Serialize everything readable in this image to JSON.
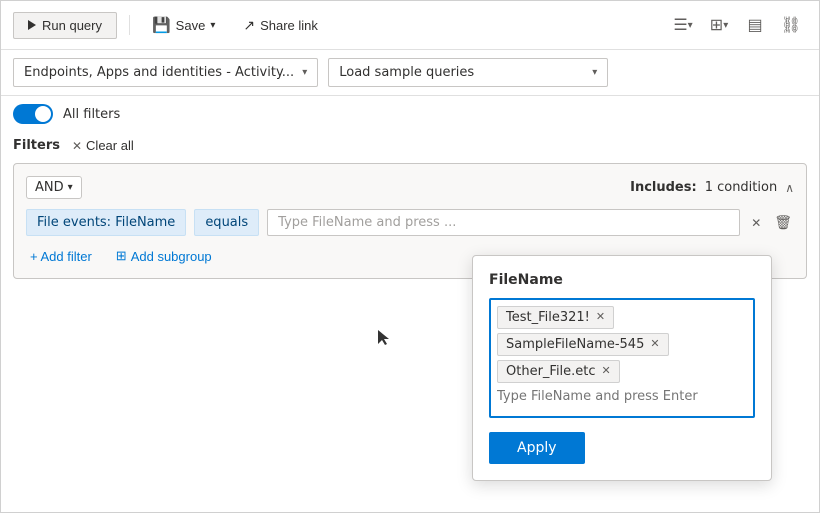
{
  "toolbar": {
    "run_query": "Run query",
    "save": "Save",
    "share_link": "Share link"
  },
  "query_bar": {
    "source_dropdown": "Endpoints, Apps and identities - Activity...",
    "sample_dropdown": "Load sample queries"
  },
  "filters": {
    "toggle_label": "All filters",
    "filters_heading": "Filters",
    "clear_all": "Clear all",
    "card": {
      "and_label": "AND",
      "includes_label": "Includes:",
      "condition_count": "1 condition",
      "filter_chip": "File events: FileName",
      "equals_chip": "equals",
      "value_placeholder": "Type FileName and press ...",
      "add_filter": "+ Add filter",
      "add_subgroup": "Add subgroup"
    }
  },
  "popup": {
    "title": "FileName",
    "tags": [
      {
        "id": 1,
        "value": "Test_File321!"
      },
      {
        "id": 2,
        "value": "SampleFileName-545"
      },
      {
        "id": 3,
        "value": "Other_File.etc"
      }
    ],
    "input_placeholder": "Type FileName and press Enter",
    "apply_label": "Apply"
  }
}
